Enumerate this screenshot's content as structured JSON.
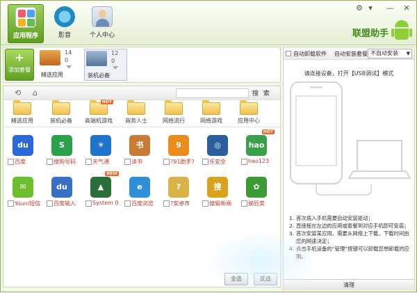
{
  "window": {
    "controls": [
      "⚙",
      "▾",
      "—",
      "✕"
    ]
  },
  "nav": [
    {
      "label": "应用程序",
      "active": true
    },
    {
      "label": "影音",
      "active": false
    },
    {
      "label": "个人中心",
      "active": false
    }
  ],
  "brand": "联盟助手",
  "packages": {
    "add_label": "添加套餐",
    "items": [
      {
        "name": "精选应用",
        "count": "14",
        "music": "0"
      },
      {
        "name": "装机必备",
        "count": "12",
        "music": "0"
      }
    ]
  },
  "toolbar": {
    "search_label": "搜 索",
    "search_placeholder": ""
  },
  "categories": [
    {
      "label": "精选应用",
      "hot": ""
    },
    {
      "label": "装机必备",
      "hot": ""
    },
    {
      "label": "高端机游戏",
      "hot": "HOT"
    },
    {
      "label": "商务人士",
      "hot": ""
    },
    {
      "label": "网络流行",
      "hot": ""
    },
    {
      "label": "网络游戏",
      "hot": ""
    },
    {
      "label": "应用中心",
      "hot": ""
    }
  ],
  "apps": [
    {
      "name": "百度",
      "icon": "baidu-icon",
      "glyph": "du",
      "color": "#2b6ad4",
      "badge": ""
    },
    {
      "name": "搜狗号码",
      "icon": "sogou-phone-icon",
      "glyph": "S",
      "color": "#2aa24b",
      "badge": ""
    },
    {
      "name": "天气通",
      "icon": "weather-icon",
      "glyph": "☀",
      "color": "#1e74c9",
      "badge": ""
    },
    {
      "name": "读书",
      "icon": "book-icon",
      "glyph": "书",
      "color": "#c77b35",
      "badge": ""
    },
    {
      "name": "?91助手?",
      "icon": "91-assistant-icon",
      "glyph": "9",
      "color": "#e98b1d",
      "badge": ""
    },
    {
      "name": "乐安全",
      "icon": "security-icon",
      "glyph": "◎",
      "color": "#2a5f9e",
      "badge": ""
    },
    {
      "name": "hao123",
      "icon": "hao123-icon",
      "glyph": "hao",
      "color": "#3aa04a",
      "badge": "HOT"
    },
    {
      "name": "Youni短信",
      "icon": "youni-sms-icon",
      "glyph": "✉",
      "color": "#6cbf2c",
      "badge": ""
    },
    {
      "name": "百度输入",
      "icon": "baidu-input-icon",
      "glyph": "du",
      "color": "#3b6fc4",
      "badge": ""
    },
    {
      "name": "System 0",
      "icon": "system-icon",
      "glyph": "▲",
      "color": "#2a6f3a",
      "badge": "NEW"
    },
    {
      "name": "百度浏览",
      "icon": "baidu-browser-icon",
      "glyph": "e",
      "color": "#2f8fd8",
      "badge": ""
    },
    {
      "name": "?安卓市",
      "icon": "android-market-icon",
      "glyph": "?",
      "color": "#d9b348",
      "badge": ""
    },
    {
      "name": "搜狐新闻",
      "icon": "sohu-news-icon",
      "glyph": "搜",
      "color": "#d9a21a",
      "badge": ""
    },
    {
      "name": "豌豆荚",
      "icon": "wandoujia-icon",
      "glyph": "✿",
      "color": "#3d9a34",
      "badge": ""
    }
  ],
  "actions": {
    "select_all": "全选",
    "invert": "反选"
  },
  "right": {
    "auto_uninstall_label": "自动卸载软件",
    "auto_install_label": "自动安装套餐:",
    "auto_install_value": "不自动安装",
    "hint": "请连接设备，打开【USB调试】模式",
    "steps": [
      {
        "n": "1.",
        "text": "首次插入手机需要自动安装驱动；"
      },
      {
        "n": "2.",
        "text": "直接拖在左边的应用或套餐到对应手机即可安装；"
      },
      {
        "n": "3.",
        "text": "首次安装某应用，需要从网络上下载，下载时间由您的网速决定；"
      },
      {
        "n": "4.",
        "text": "点击手机设备的“管理”按键可以卸载您想卸载的应用。"
      }
    ],
    "clean_label": "清理"
  }
}
